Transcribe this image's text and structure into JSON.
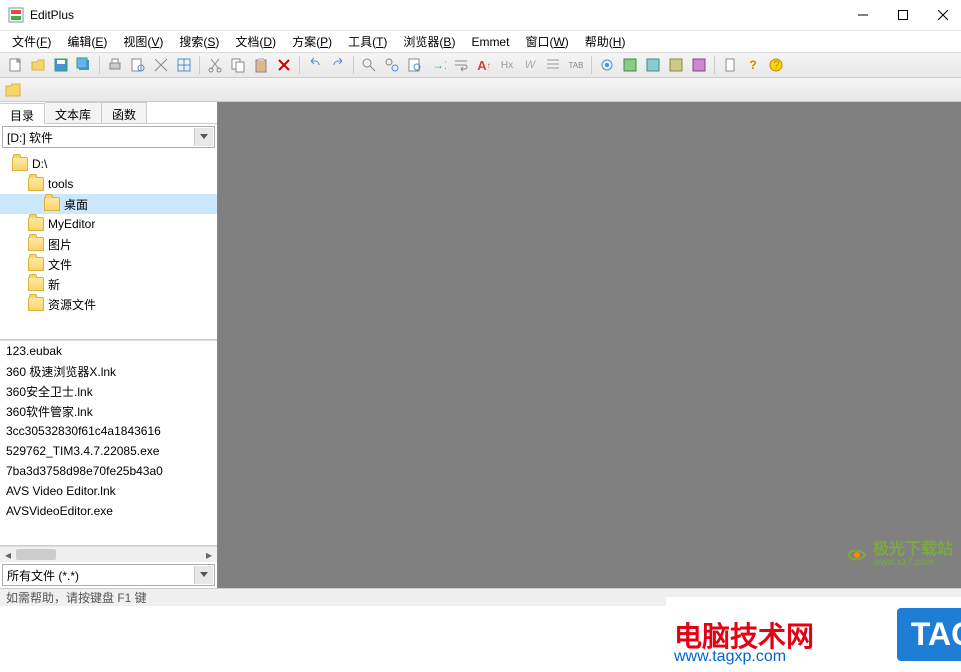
{
  "window": {
    "title": "EditPlus"
  },
  "menus": [
    {
      "label": "文件(",
      "key": "F",
      "suffix": ")"
    },
    {
      "label": "编辑(",
      "key": "E",
      "suffix": ")"
    },
    {
      "label": "视图(",
      "key": "V",
      "suffix": ")"
    },
    {
      "label": "搜索(",
      "key": "S",
      "suffix": ")"
    },
    {
      "label": "文档(",
      "key": "D",
      "suffix": ")"
    },
    {
      "label": "方案(",
      "key": "P",
      "suffix": ")"
    },
    {
      "label": "工具(",
      "key": "T",
      "suffix": ")"
    },
    {
      "label": "浏览器(",
      "key": "B",
      "suffix": ")"
    },
    {
      "label": "Emmet",
      "key": "",
      "suffix": ""
    },
    {
      "label": "窗口(",
      "key": "W",
      "suffix": ")"
    },
    {
      "label": "帮助(",
      "key": "H",
      "suffix": ")"
    }
  ],
  "sidebar": {
    "tabs": [
      "目录",
      "文本库",
      "函数"
    ],
    "active_tab": 0,
    "drive": "[D:] 软件",
    "tree": [
      {
        "label": "D:\\",
        "indent": 0,
        "selected": false
      },
      {
        "label": "tools",
        "indent": 1,
        "selected": false
      },
      {
        "label": "桌面",
        "indent": 2,
        "selected": true
      },
      {
        "label": "MyEditor",
        "indent": 1,
        "selected": false
      },
      {
        "label": "图片",
        "indent": 1,
        "selected": false
      },
      {
        "label": "文件",
        "indent": 1,
        "selected": false
      },
      {
        "label": "新",
        "indent": 1,
        "selected": false
      },
      {
        "label": "资源文件",
        "indent": 1,
        "selected": false
      }
    ],
    "files": [
      "123.eubak",
      "360 极速浏览器X.lnk",
      "360安全卫士.lnk",
      "360软件管家.lnk",
      "3cc30532830f61c4a1843616",
      "529762_TIM3.4.7.22085.exe",
      "7ba3d3758d98e70fe25b43a0",
      "AVS Video Editor.lnk",
      "AVSVideoEditor.exe"
    ],
    "filter": "所有文件 (*.*)"
  },
  "status": "如需帮助，请按键盘 F1 键",
  "watermark1": {
    "brand": "电脑技术网",
    "url": "www.tagxp.com",
    "tag": "TAG"
  },
  "watermark2": {
    "text": "极光下载站",
    "sub": "www.xz7.com"
  }
}
